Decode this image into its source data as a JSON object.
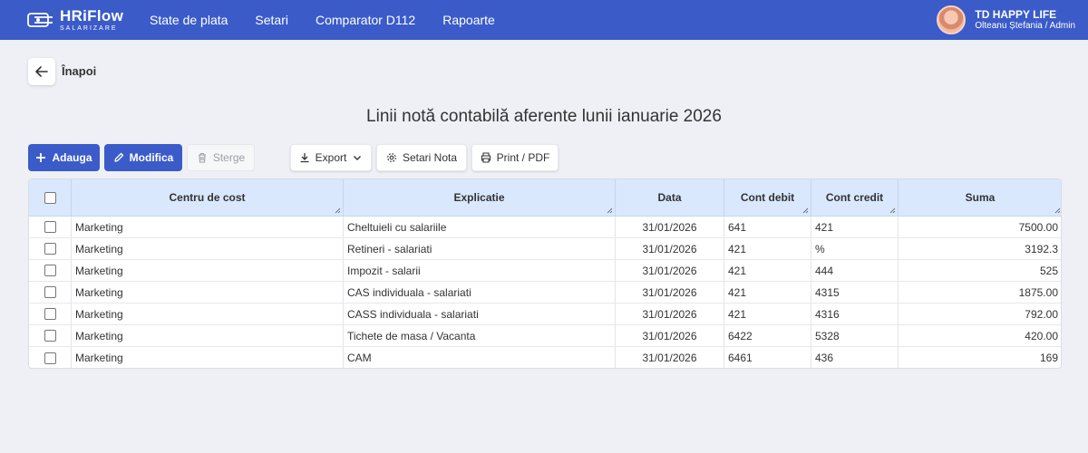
{
  "app": {
    "logo_name": "HRiFlow",
    "logo_sub": "SALARIZARE"
  },
  "nav": [
    {
      "label": "State de plata"
    },
    {
      "label": "Setari"
    },
    {
      "label": "Comparator D112"
    },
    {
      "label": "Rapoarte"
    }
  ],
  "user": {
    "company": "TD HAPPY LIFE",
    "role": "Olteanu Ștefania / Admin"
  },
  "back": {
    "label": "Înapoi"
  },
  "page": {
    "title": "Linii notă contabilă aferente lunii ianuarie 2026"
  },
  "toolbar": {
    "add": "Adauga",
    "edit": "Modifica",
    "delete": "Sterge",
    "export": "Export",
    "settings": "Setari Nota",
    "print": "Print / PDF"
  },
  "table": {
    "headers": {
      "cost": "Centru de cost",
      "exp": "Explicatie",
      "date": "Data",
      "debit": "Cont debit",
      "credit": "Cont credit",
      "sum": "Suma"
    },
    "rows": [
      {
        "cost": "Marketing",
        "exp": "Cheltuieli cu salariile",
        "date": "31/01/2026",
        "debit": "641",
        "credit": "421",
        "sum": "7500.00"
      },
      {
        "cost": "Marketing",
        "exp": "Retineri - salariati",
        "date": "31/01/2026",
        "debit": "421",
        "credit": "%",
        "sum": "3192.3"
      },
      {
        "cost": "Marketing",
        "exp": "Impozit - salarii",
        "date": "31/01/2026",
        "debit": "421",
        "credit": "444",
        "sum": "525"
      },
      {
        "cost": "Marketing",
        "exp": "CAS individuala - salariati",
        "date": "31/01/2026",
        "debit": "421",
        "credit": "4315",
        "sum": "1875.00"
      },
      {
        "cost": "Marketing",
        "exp": "CASS individuala - salariati",
        "date": "31/01/2026",
        "debit": "421",
        "credit": "4316",
        "sum": "792.00"
      },
      {
        "cost": "Marketing",
        "exp": "Tichete de masa / Vacanta",
        "date": "31/01/2026",
        "debit": "6422",
        "credit": "5328",
        "sum": "420.00"
      },
      {
        "cost": "Marketing",
        "exp": "CAM",
        "date": "31/01/2026",
        "debit": "6461",
        "credit": "436",
        "sum": "169"
      }
    ]
  },
  "colors": {
    "brand": "#3b5bc9",
    "header_bg": "#d9e8fd",
    "page_bg": "#eef0f5"
  }
}
